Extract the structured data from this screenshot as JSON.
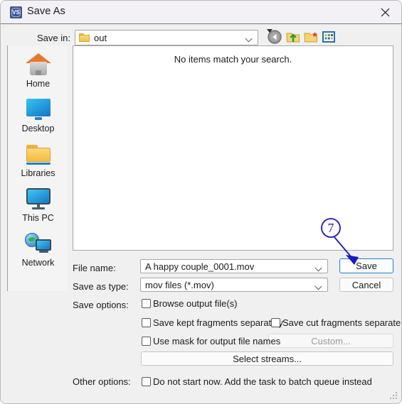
{
  "window": {
    "title": "Save As",
    "app_icon": "vs-logo-icon",
    "icon_text": "VS",
    "close_label": "✕"
  },
  "toolbar": {
    "save_in_label": "Save in:",
    "current_folder": "out",
    "buttons": [
      {
        "name": "back-button",
        "icon": "back-arrow-icon"
      },
      {
        "name": "up-one-level-button",
        "icon": "up-folder-icon"
      },
      {
        "name": "create-new-folder-button",
        "icon": "new-folder-icon"
      },
      {
        "name": "views-button",
        "icon": "views-grid-icon"
      }
    ]
  },
  "sidebar": {
    "items": [
      {
        "label": "Home",
        "icon": "home-icon"
      },
      {
        "label": "Desktop",
        "icon": "desktop-monitor-icon"
      },
      {
        "label": "Libraries",
        "icon": "libraries-folder-icon"
      },
      {
        "label": "This PC",
        "icon": "this-pc-monitor-icon"
      },
      {
        "label": "Network",
        "icon": "network-globe-icon"
      }
    ]
  },
  "file_list": {
    "empty_message": "No items match your search.",
    "items": []
  },
  "form": {
    "file_name_label": "File name:",
    "file_name_value": "A happy couple_0001.mov",
    "save_as_type_label": "Save as type:",
    "save_as_type_value": "mov files (*.mov)",
    "save_options_label": "Save options:",
    "other_options_label": "Other options:",
    "checkboxes": [
      {
        "label": "Browse output file(s)",
        "checked": false
      },
      {
        "label": "Save kept fragments separately",
        "checked": false
      },
      {
        "label": "Save cut fragments separately",
        "checked": false
      },
      {
        "label": "Use mask for output file names",
        "checked": false
      },
      {
        "label": "Do not start now. Add the task to batch queue instead",
        "checked": false
      }
    ],
    "custom_button": "Custom...",
    "custom_button_enabled": false,
    "select_streams_button": "Select streams...",
    "save_button": "Save",
    "cancel_button": "Cancel"
  },
  "annotation": {
    "step_number": "7",
    "color": "#1a18c8",
    "target": "save-button"
  },
  "colors": {
    "titlebar_bg": "#f3f1f5",
    "dialog_bg": "#f0f0f0",
    "sidebar_bg": "#f4f4f4",
    "list_bg": "#ffffff",
    "focus_border": "#1a7fd4",
    "annotation": "#1a18c8"
  }
}
